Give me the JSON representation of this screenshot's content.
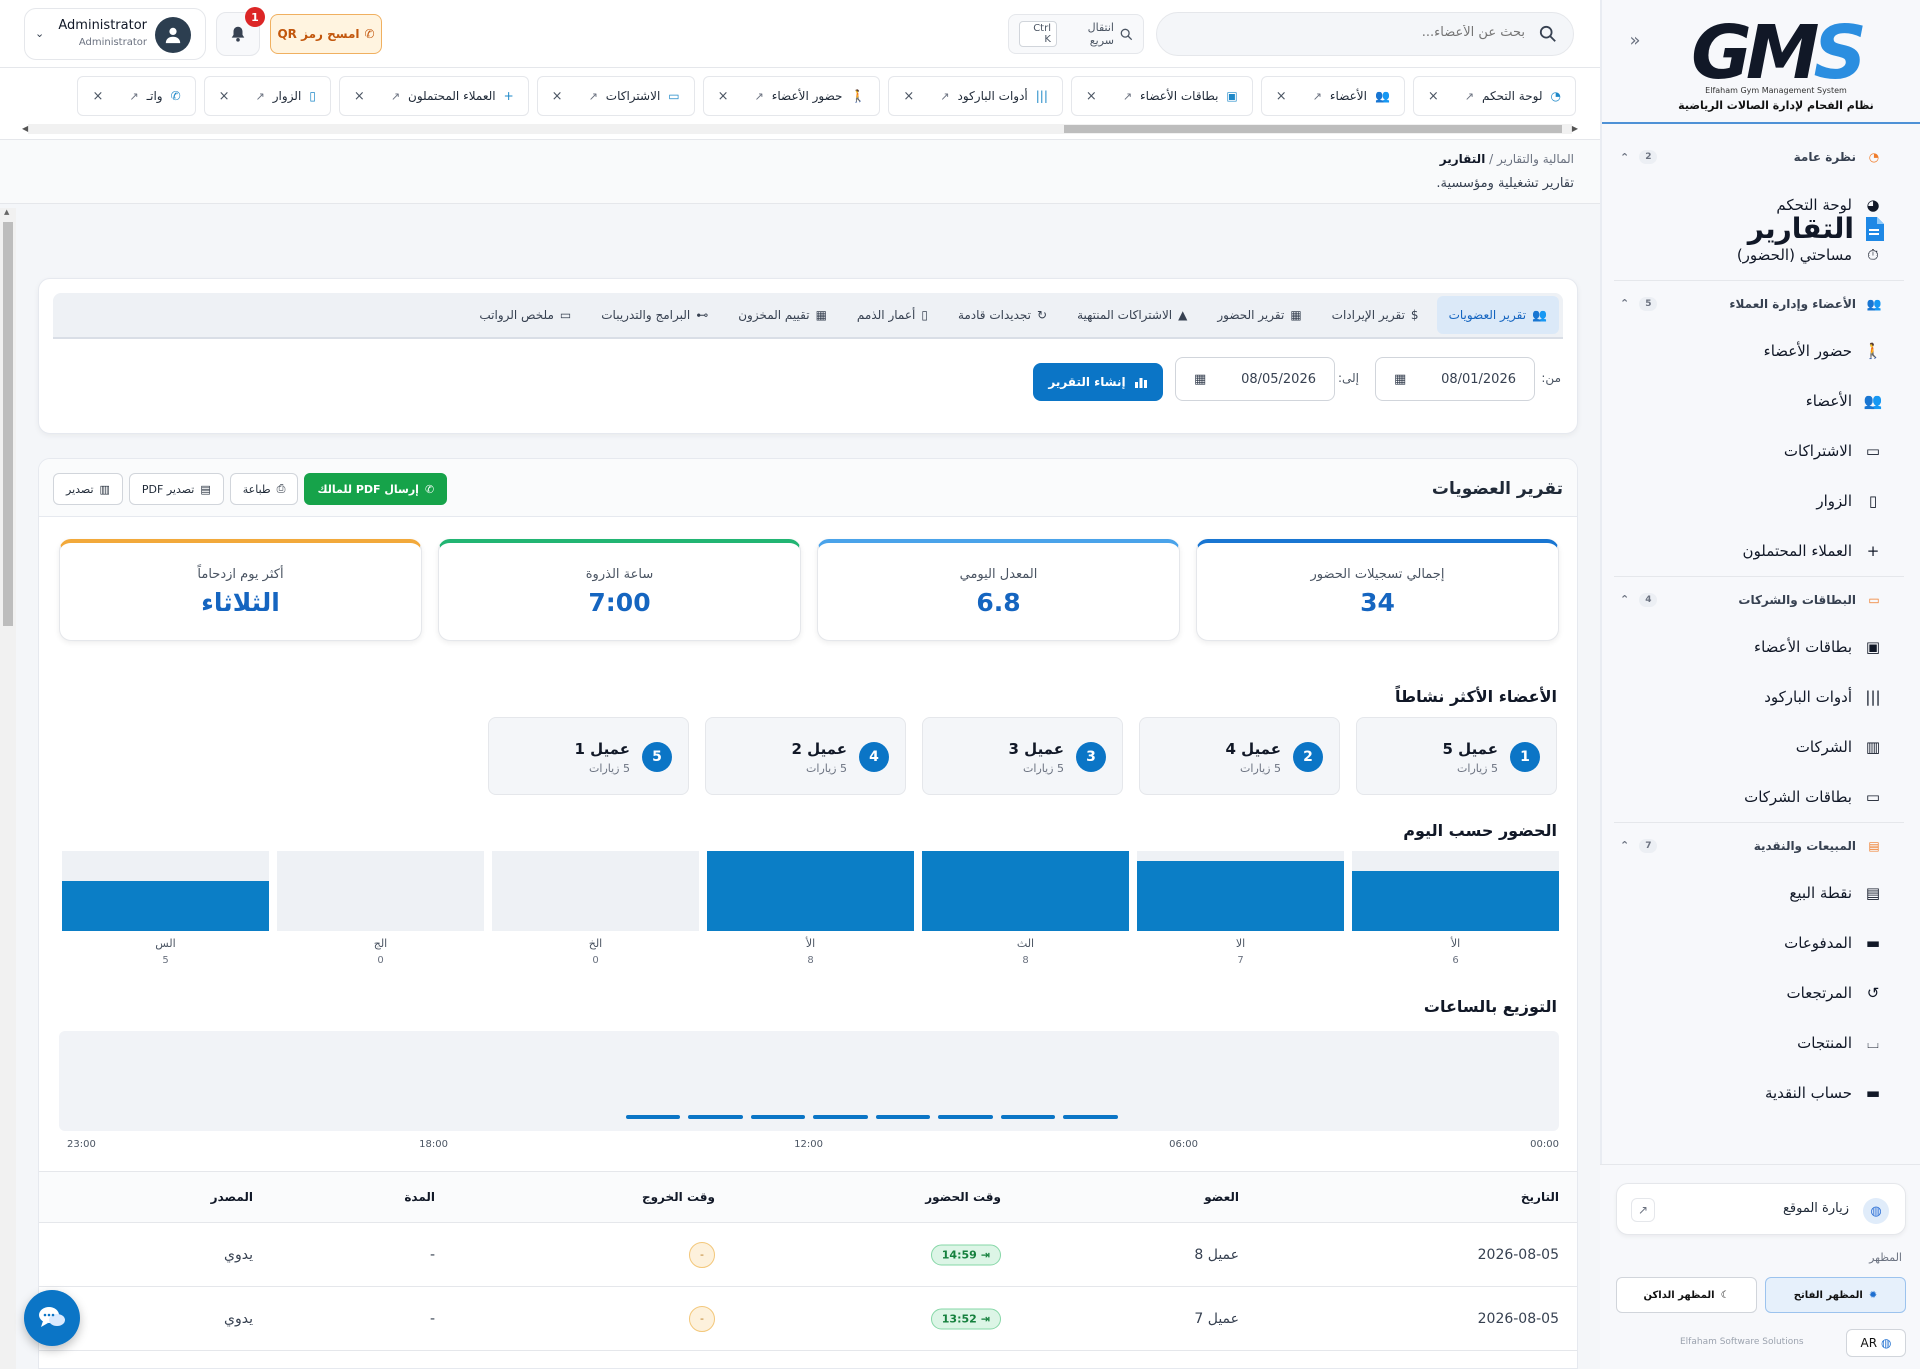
{
  "sidebar": {
    "logo": {
      "mark_left": "G",
      "mark_mid": "M",
      "mark_right": "S",
      "subtitle": "Elfaham Gym Management System",
      "tagline": "نظام الفحام لإدارة الصالات الرياضية"
    },
    "groups": [
      {
        "title": "نظرة عامة",
        "count": "2",
        "icon": "gauge-icon",
        "items": [
          {
            "label": "لوحة التحكم",
            "icon": "dashboard-icon"
          },
          {
            "label": "مساحتي (الحضور)",
            "icon": "stopwatch-icon"
          }
        ]
      },
      {
        "title": "الأعضاء وإدارة العملاء",
        "count": "5",
        "icon": "users-icon",
        "items": [
          {
            "label": "حضور الأعضاء",
            "icon": "walking-icon"
          },
          {
            "label": "الأعضاء",
            "icon": "users-icon"
          },
          {
            "label": "الاشتراكات",
            "icon": "id-card-icon"
          },
          {
            "label": "الزوار",
            "icon": "door-icon"
          },
          {
            "label": "العملاء المحتملون",
            "icon": "user-plus-icon"
          }
        ]
      },
      {
        "title": "البطاقات والشركات",
        "count": "4",
        "icon": "card-icon",
        "items": [
          {
            "label": "بطاقات الأعضاء",
            "icon": "badge-icon"
          },
          {
            "label": "أدوات الباركود",
            "icon": "barcode-icon"
          },
          {
            "label": "الشركات",
            "icon": "building-icon"
          },
          {
            "label": "بطاقات الشركات",
            "icon": "address-card-icon"
          }
        ]
      },
      {
        "title": "المبيعات والنقدية",
        "count": "7",
        "icon": "cash-register-icon",
        "items": [
          {
            "label": "نقطة البيع",
            "icon": "register-icon"
          },
          {
            "label": "المدفوعات",
            "icon": "money-icon"
          },
          {
            "label": "المرتجعات",
            "icon": "undo-icon"
          },
          {
            "label": "المنتجات",
            "icon": "basket-icon"
          },
          {
            "label": "حساب النقدية",
            "icon": "wallet-icon"
          }
        ]
      }
    ],
    "visit_site": "زيارة الموقع",
    "appearance_label": "المظهر",
    "theme_dark": "المظهر الداكن",
    "theme_light": "المظهر الفاتح",
    "lang": "AR",
    "copyright": "Elfaham Software Solutions"
  },
  "topbar": {
    "search_placeholder": "بحث عن الأعضاء...",
    "quick_jump": "انتقال سريع",
    "quick_kbd": "Ctrl K",
    "qr_button": "امسح رمز QR",
    "notif_count": "1",
    "user_name": "Administrator",
    "user_role": "Administrator"
  },
  "tabs": [
    {
      "label": "لوحة التحكم",
      "icon": "gauge-icon"
    },
    {
      "label": "الأعضاء",
      "icon": "users-icon"
    },
    {
      "label": "بطاقات الأعضاء",
      "icon": "badge-icon"
    },
    {
      "label": "أدوات الباركود",
      "icon": "barcode-icon"
    },
    {
      "label": "حضور الأعضاء",
      "icon": "walking-icon"
    },
    {
      "label": "الاشتراكات",
      "icon": "id-card-icon"
    },
    {
      "label": "العملاء المحتملون",
      "icon": "user-plus-icon"
    },
    {
      "label": "الزوار",
      "icon": "door-icon"
    },
    {
      "label": "واتـ",
      "icon": "whatsapp-icon"
    }
  ],
  "breadcrumb": {
    "parent": "المالية والتقارير",
    "current": "التقارير",
    "subtitle": "تقارير تشغيلية ومؤسسية."
  },
  "page_title": "التقارير",
  "report_tabs": [
    {
      "label": "تقرير العضويات",
      "icon": "users-icon",
      "active": true
    },
    {
      "label": "تقرير الإيرادات",
      "icon": "dollar-icon"
    },
    {
      "label": "تقرير الحضور",
      "icon": "calendar-check-icon"
    },
    {
      "label": "الاشتراكات المنتهية",
      "icon": "warning-icon"
    },
    {
      "label": "تجديدات قادمة",
      "icon": "refresh-icon"
    },
    {
      "label": "أعمار الذمم",
      "icon": "invoice-icon"
    },
    {
      "label": "تقييم المخزون",
      "icon": "boxes-icon"
    },
    {
      "label": "البرامج والتدريبات",
      "icon": "dumbbell-icon"
    },
    {
      "label": "ملخص الرواتب",
      "icon": "money-check-icon"
    }
  ],
  "filters": {
    "from_label": "من:",
    "to_label": "إلى:",
    "from_date": "08/01/2026",
    "to_date": "08/05/2026",
    "generate": "إنشاء التقرير"
  },
  "report": {
    "title": "تقرير العضويات",
    "buttons": {
      "export": "تصدير",
      "export_pdf": "تصدير PDF",
      "print": "طباعة",
      "send_pdf": "إرسال PDF للمالك"
    },
    "stats": [
      {
        "label": "إجمالي تسجيلات الحضور",
        "value": "34",
        "color": "#1976d2"
      },
      {
        "label": "المعدل اليومي",
        "value": "6.8",
        "color": "#4aa3ea"
      },
      {
        "label": "ساعة الذروة",
        "value": "7:00",
        "color": "#22b573"
      },
      {
        "label": "أكثر يوم ازدحاماً",
        "value": "الثلاثاء",
        "color": "#f2a93b"
      }
    ],
    "top_members_title": "الأعضاء الأكثر نشاطاً",
    "top_members": [
      {
        "rank": "1",
        "name": "عميل 5",
        "visits": "5 زيارات"
      },
      {
        "rank": "2",
        "name": "عميل 4",
        "visits": "5 زيارات"
      },
      {
        "rank": "3",
        "name": "عميل 3",
        "visits": "5 زيارات"
      },
      {
        "rank": "4",
        "name": "عميل 2",
        "visits": "5 زيارات"
      },
      {
        "rank": "5",
        "name": "عميل 1",
        "visits": "5 زيارات"
      }
    ],
    "by_day_title": "الحضور حسب اليوم",
    "hours_title": "التوزيع بالساعات",
    "hour_ticks": [
      "00:00",
      "06:00",
      "12:00",
      "18:00",
      "23:00"
    ],
    "table": {
      "headers": {
        "date": "التاريخ",
        "member": "العضو",
        "check_in": "وقت الحضور",
        "check_out": "وقت الخروج",
        "duration": "المدة",
        "source": "المصدر"
      },
      "rows": [
        {
          "date": "2026-08-05",
          "member": "عميل 8",
          "check_in": "14:59",
          "check_out": "-",
          "duration": "-",
          "source": "يدوي"
        },
        {
          "date": "2026-08-05",
          "member": "عميل 7",
          "check_in": "13:52",
          "check_out": "-",
          "duration": "-",
          "source": "يدوي"
        }
      ]
    }
  },
  "chart_data": [
    {
      "type": "bar",
      "title": "الحضور حسب اليوم",
      "categories": [
        "الأ",
        "الا",
        "الث",
        "الأ",
        "الخ",
        "الج",
        "الس"
      ],
      "values": [
        6,
        7,
        8,
        8,
        0,
        0,
        5
      ],
      "ylim": [
        0,
        8
      ]
    },
    {
      "type": "bar",
      "title": "التوزيع بالساعات",
      "x": [
        "00:00",
        "06:00",
        "12:00",
        "18:00",
        "23:00"
      ],
      "series": [
        {
          "values": [
            0,
            0,
            0,
            0,
            0,
            0,
            0,
            1,
            1,
            1,
            1,
            1,
            1,
            1,
            1,
            0,
            0,
            0,
            0,
            0,
            0,
            0,
            0,
            0
          ]
        }
      ]
    }
  ]
}
